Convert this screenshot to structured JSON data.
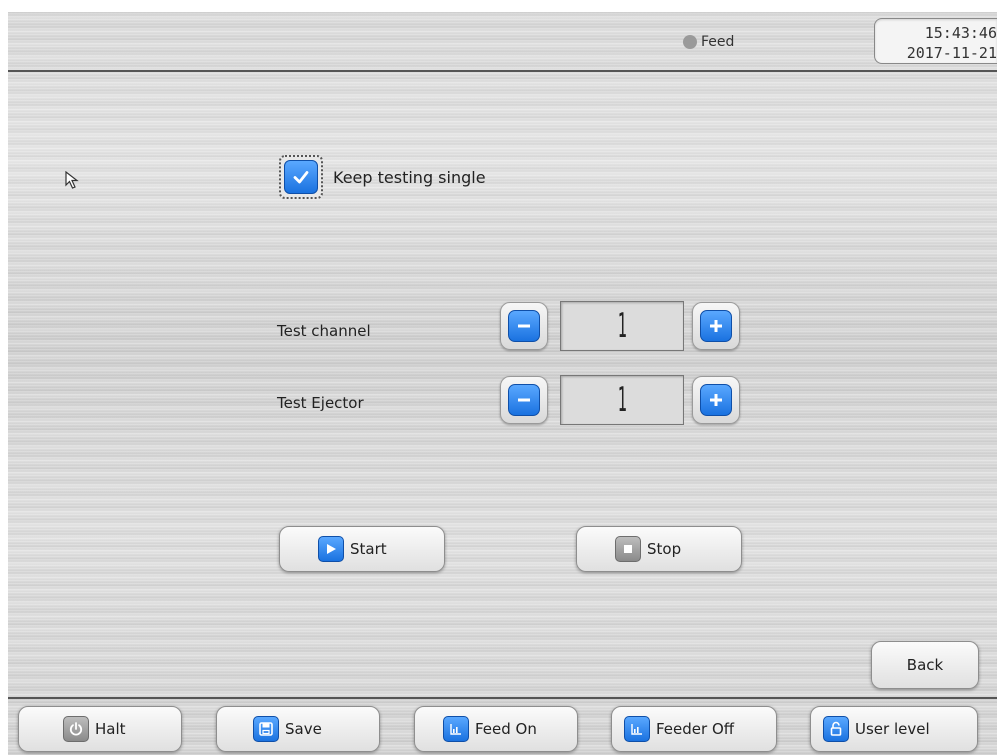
{
  "status": {
    "label": "Feed",
    "indicator_color": "#9a9a9a"
  },
  "clock": {
    "time": "15:43:46",
    "date": "2017-11-21"
  },
  "checkbox": {
    "label": "Keep testing single",
    "checked": true
  },
  "test_channel": {
    "label": "Test channel",
    "value": "1"
  },
  "test_ejector": {
    "label": "Test Ejector",
    "value": "1"
  },
  "actions": {
    "start_label": "Start",
    "stop_label": "Stop",
    "back_label": "Back"
  },
  "toolbar": {
    "halt_label": "Halt",
    "save_label": "Save",
    "feed_on_label": "Feed On",
    "feeder_off_label": "Feeder Off",
    "user_level_label": "User level"
  },
  "colors": {
    "accent": "#1a72e0",
    "text": "#222222"
  }
}
